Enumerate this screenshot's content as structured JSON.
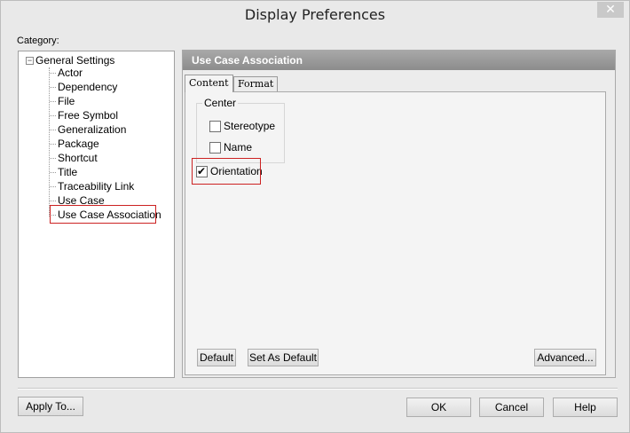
{
  "window": {
    "title": "Display Preferences",
    "close_glyph": "✕"
  },
  "category": {
    "label": "Category:",
    "root": {
      "label": "General Settings",
      "toggle": "−"
    },
    "items": [
      "Actor",
      "Dependency",
      "File",
      "Free Symbol",
      "Generalization",
      "Package",
      "Shortcut",
      "Title",
      "Traceability Link",
      "Use Case",
      "Use Case Association"
    ],
    "selected": "Use Case Association"
  },
  "panel": {
    "header": "Use Case Association",
    "tabs": [
      "Content",
      "Format"
    ],
    "active_tab": "Content",
    "center_group": {
      "title": "Center",
      "stereotype_label": "Stereotype",
      "stereotype_checked": false,
      "name_label": "Name",
      "name_checked": false
    },
    "orientation_label": "Orientation",
    "orientation_checked": true,
    "buttons": {
      "default": "Default",
      "set_as_default": "Set As Default",
      "advanced": "Advanced..."
    }
  },
  "footer": {
    "apply_to": "Apply To...",
    "ok": "OK",
    "cancel": "Cancel",
    "help": "Help"
  },
  "colors": {
    "highlight_border": "#cc2222",
    "panel_header": "#999999"
  },
  "icons": {
    "close": "close-icon",
    "tree_toggle": "collapse-icon",
    "checkmark": "checkmark-icon"
  }
}
